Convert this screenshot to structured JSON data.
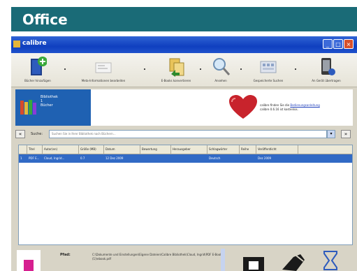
{
  "banner": {
    "title": "Office",
    "color": "#1a6b77"
  },
  "window": {
    "title": "calibre",
    "buttons": {
      "minimize": "_",
      "maximize": "□",
      "close": "×"
    }
  },
  "toolbar": {
    "items": [
      {
        "label": "Bücher hinzufügen",
        "icon": "add-book-icon"
      },
      {
        "label": "Meta-Informationen bearbeiten",
        "icon": "edit-metadata-icon"
      },
      {
        "label": "E-Books konvertieren",
        "icon": "convert-icon"
      },
      {
        "label": "Ansehen",
        "icon": "view-icon"
      },
      {
        "label": "Gespeicherte Suchen",
        "icon": "saved-searches-icon"
      },
      {
        "label": "An Gerät übertragen",
        "icon": "device-icon"
      }
    ]
  },
  "info": {
    "library_label": "Bibliothek\n1\nBücher",
    "text_prefix": "calibre finden Sie die",
    "link": "Bedienungsanleitung",
    "text_suffix": "calibre 0.6.16 ist kostenlos."
  },
  "nav": {
    "prev": "«",
    "label": "Suche:",
    "search_placeholder": "Suchen Sie in Ihrer Bibliothek nach Büchern...",
    "dropdown": "▾",
    "next": "»"
  },
  "table": {
    "columns": [
      "Titel",
      "Autor(en)",
      "Größe (MB)",
      "Datum",
      "Bewertung",
      "Herausgeber",
      "Schlagwörter",
      "Reihe",
      "Veröffentlicht"
    ],
    "rows": [
      [
        "PDF E...",
        "Cloud, Ingrid...",
        "0.7",
        "12 Dez 2009",
        "",
        "",
        "Deutsch",
        "",
        "Dez 2009"
      ]
    ]
  },
  "bottom": {
    "meta_label": "Pfad:",
    "meta_text": "C:\\Dokumente und Einstellungen\\Eigene Dateien\\Calibre Bibliothek\\Cloud, Ingrid\\PDF E-Book (1)\\ebook.pdf"
  },
  "colors": {
    "selection": "#316ac5",
    "library_box": "#1f61b2",
    "titlebar": "#0f3fbf",
    "heart": "#c8232c"
  }
}
